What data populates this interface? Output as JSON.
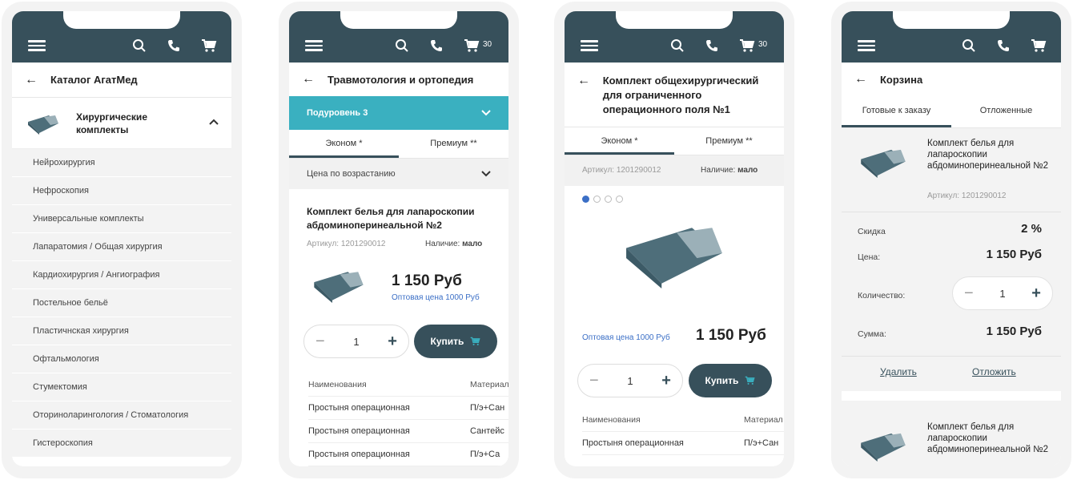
{
  "screen1": {
    "title": "Каталог АгатМед",
    "category": "Хирургические комплекты",
    "items": [
      "Нейрохирургия",
      "Нефроскопия",
      "Универсальные комплекты",
      "Лапаратомия / Общая хирургия",
      "Кардиохирургия / Ангиография",
      "Постельное бельё",
      "Пластичнская хирургия",
      "Офтальмология",
      "Стумектомия",
      "Оториноларингология / Стоматология",
      "Гистероскопия"
    ]
  },
  "screen2": {
    "cart_count": "30",
    "title": "Травмотология и ортопедия",
    "sublevel": "Подуровень 3",
    "tabs": [
      "Эконом *",
      "Премиум **"
    ],
    "sort": "Цена по возрастанию",
    "product_name": "Комплект белья для лапароскопии абдоминоперинеальной №2",
    "sku": "Артикул: 1201290012",
    "stock_label": "Наличие:",
    "stock_value": "мало",
    "price": "1 150 Руб",
    "wholesale": "Оптовая цена 1000 Руб",
    "qty": "1",
    "buy": "Купить",
    "col1": "Наименования",
    "col2": "Материал",
    "rows": [
      [
        "Простыня операционная",
        "П/э+Сан"
      ],
      [
        "Простыня операционная",
        "Сантейс"
      ],
      [
        "Простыня операционная",
        "П/э+Са"
      ]
    ]
  },
  "screen3": {
    "cart_count": "30",
    "title": "Комплект общехирургический для ограниченного операционного поля №1",
    "tabs": [
      "Эконом *",
      "Премиум **"
    ],
    "sku": "Артикул: 1201290012",
    "stock_label": "Наличие:",
    "stock_value": "мало",
    "wholesale": "Оптовая цена 1000 Руб",
    "price": "1 150 Руб",
    "qty": "1",
    "buy": "Купить",
    "col1": "Наименования",
    "col2": "Материал",
    "rows": [
      [
        "Простыня операционная",
        "П/э+Сан"
      ]
    ]
  },
  "screen4": {
    "title": "Корзина",
    "tabs": [
      "Готовые к заказу",
      "Отложенные"
    ],
    "product_name": "Комплект белья для лапароскопии абдоминоперинеальной №2",
    "sku": "Артикул: 1201290012",
    "discount_label": "Скидка",
    "discount_value": "2 %",
    "price_label": "Цена:",
    "price_value": "1 150 Руб",
    "qty_label": "Количество:",
    "qty": "1",
    "sum_label": "Сумма:",
    "sum_value": "1 150 Руб",
    "delete": "Удалить",
    "postpone": "Отложить",
    "product2_name": "Комплект белья для лапароскопии абдоминоперинеальной №2"
  },
  "colors": {
    "header": "#37505b",
    "accent": "#3ab0c0",
    "link": "#3b6fc6"
  },
  "icons": [
    "hamburger-icon",
    "search-icon",
    "phone-icon",
    "cart-icon",
    "back-arrow-icon",
    "chevron-up-icon",
    "chevron-down-icon",
    "minus-icon",
    "plus-icon"
  ]
}
